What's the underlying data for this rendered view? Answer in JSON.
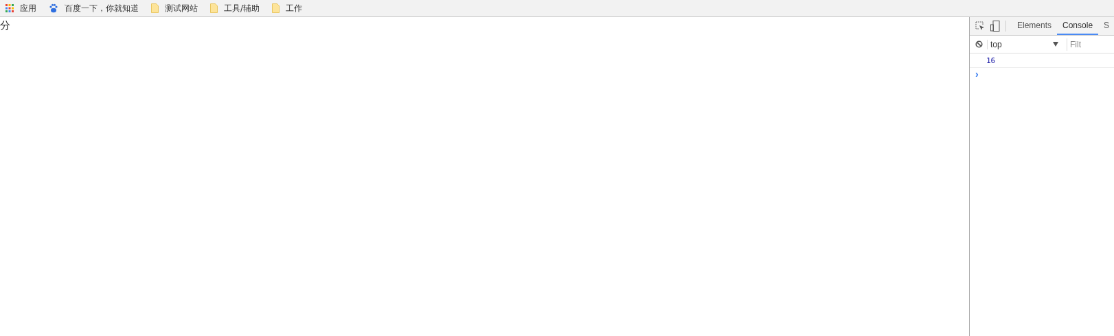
{
  "bookmarks": [
    {
      "kind": "apps",
      "label": "应用"
    },
    {
      "kind": "paw",
      "label": "百度一下，你就知道"
    },
    {
      "kind": "folder",
      "label": "测试网站"
    },
    {
      "kind": "folder",
      "label": "工具/辅助"
    },
    {
      "kind": "folder",
      "label": "工作"
    }
  ],
  "page": {
    "text": "分"
  },
  "devtools": {
    "tabs": [
      {
        "label": "Elements",
        "selected": false
      },
      {
        "label": "Console",
        "selected": true
      },
      {
        "label": "S",
        "selected": false
      }
    ],
    "context": "top",
    "filter": {
      "placeholder": "Filt"
    },
    "logs": [
      {
        "value": "16"
      }
    ],
    "prompt": "›"
  }
}
